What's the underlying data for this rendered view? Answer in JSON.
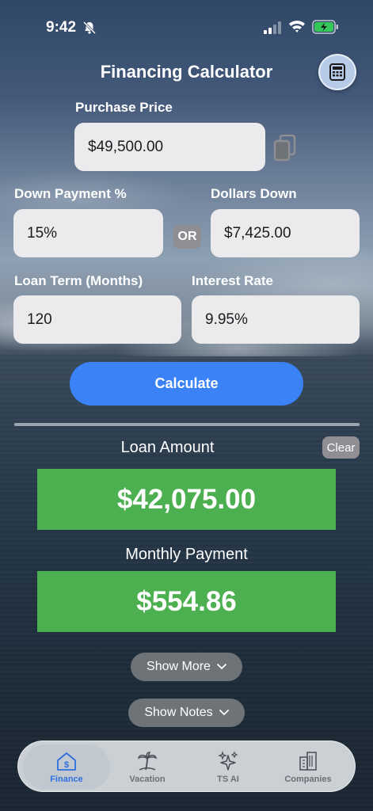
{
  "status": {
    "time": "9:42"
  },
  "header": {
    "title": "Financing Calculator"
  },
  "form": {
    "purchase_price_label": "Purchase Price",
    "purchase_price_value": "$49,500.00",
    "down_payment_pct_label": "Down Payment %",
    "down_payment_pct_value": "15%",
    "or_label": "OR",
    "dollars_down_label": "Dollars Down",
    "dollars_down_value": "$7,425.00",
    "loan_term_label": "Loan Term (Months)",
    "loan_term_value": "120",
    "interest_rate_label": "Interest Rate",
    "interest_rate_value": "9.95%",
    "calculate_label": "Calculate"
  },
  "results": {
    "loan_amount_label": "Loan Amount",
    "loan_amount_value": "$42,075.00",
    "clear_label": "Clear",
    "monthly_payment_label": "Monthly Payment",
    "monthly_payment_value": "$554.86",
    "result_color": "#4caf50"
  },
  "actions": {
    "show_more_label": "Show More",
    "show_notes_label": "Show Notes"
  },
  "tabs": [
    {
      "label": "Finance",
      "icon": "house-dollar-icon",
      "active": true
    },
    {
      "label": "Vacation",
      "icon": "palm-tree-icon",
      "active": false
    },
    {
      "label": "TS AI",
      "icon": "sparkles-icon",
      "active": false
    },
    {
      "label": "Companies",
      "icon": "buildings-icon",
      "active": false
    }
  ],
  "colors": {
    "accent": "#3b82f6",
    "tab_active": "#2f6fe0"
  }
}
